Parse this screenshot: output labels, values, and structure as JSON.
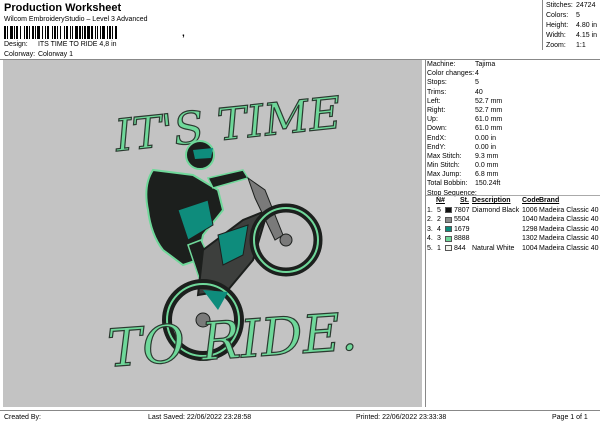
{
  "header": {
    "title": "Production Worksheet",
    "subtitle": "Wilcom EmbroideryStudio – Level 3 Advanced",
    "barcode_tail": ","
  },
  "design": {
    "design_label": "Design:",
    "design_value": "ITS TIME TO RIDE 4,8 in",
    "colorway_label": "Colorway:",
    "colorway_value": "Colorway 1"
  },
  "stats": [
    {
      "label": "Stitches:",
      "value": "24724"
    },
    {
      "label": "Colors:",
      "value": "5"
    },
    {
      "label": "Height:",
      "value": "4.80 in"
    },
    {
      "label": "Width:",
      "value": "4.15 in"
    },
    {
      "label": "Zoom:",
      "value": "1:1"
    }
  ],
  "info": [
    {
      "label": "Machine:",
      "value": "Tajima"
    },
    {
      "label": "Color changes:",
      "value": "4"
    },
    {
      "label": "Stops:",
      "value": "5"
    },
    {
      "label": "Trims:",
      "value": "40"
    },
    {
      "label": "Left:",
      "value": "52.7 mm"
    },
    {
      "label": "Right:",
      "value": "52.7 mm"
    },
    {
      "label": "Up:",
      "value": "61.0 mm"
    },
    {
      "label": "Down:",
      "value": "61.0 mm"
    },
    {
      "label": "EndX:",
      "value": "0.00 in"
    },
    {
      "label": "EndY:",
      "value": "0.00 in"
    },
    {
      "label": "Max Stitch:",
      "value": "9.3 mm"
    },
    {
      "label": "Min Stitch:",
      "value": "0.0 mm"
    },
    {
      "label": "Max Jump:",
      "value": "6.8 mm"
    },
    {
      "label": "Total Bobbin:",
      "value": "150.24ft"
    }
  ],
  "stop_sequence": {
    "title": "Stop Sequence:",
    "headers": {
      "n": "N#",
      "st": "St.",
      "desc": "Description",
      "code": "Code",
      "brand": "Brand"
    },
    "rows": [
      {
        "stop": "1.",
        "n": "5",
        "color": "#111111",
        "st": "7807",
        "desc": "Diamond Black",
        "code": "1006",
        "brand": "Madeira Classic 40"
      },
      {
        "stop": "2.",
        "n": "2",
        "color": "#8a8a8a",
        "st": "5504",
        "desc": "",
        "code": "1040",
        "brand": "Madeira Classic 40"
      },
      {
        "stop": "3.",
        "n": "4",
        "color": "#0e8c7c",
        "st": "1679",
        "desc": "",
        "code": "1298",
        "brand": "Madeira Classic 40"
      },
      {
        "stop": "4.",
        "n": "3",
        "color": "#6fd89a",
        "st": "8888",
        "desc": "",
        "code": "1302",
        "brand": "Madeira Classic 40"
      },
      {
        "stop": "5.",
        "n": "1",
        "color": "#f4f4ee",
        "st": "844",
        "desc": "Natural White",
        "code": "1004",
        "brand": "Madeira Classic 40"
      }
    ]
  },
  "artwork": {
    "top_text": "IT'S TIME",
    "bottom_text": "TO RIDE.",
    "text_color": "#6fd89a",
    "outline_color": "#1a2a22",
    "teal_color": "#0e8c7c"
  },
  "footer": {
    "created_by": "Created By:",
    "last_saved": "Last Saved: 22/06/2022 23:28:58",
    "printed": "Printed: 22/06/2022 23:33:38",
    "page": "Page 1 of 1"
  }
}
